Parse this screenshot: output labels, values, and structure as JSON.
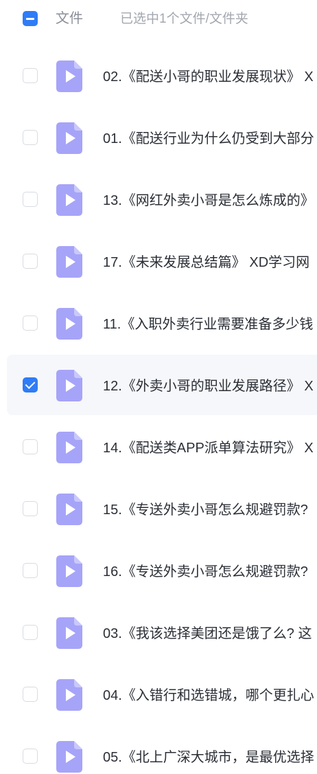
{
  "header": {
    "column_label": "文件",
    "selection_text": "已选中1个文件/文件夹",
    "select_all_state": "indeterminate"
  },
  "colors": {
    "accent": "#2f7cf6",
    "file_icon": "#a6a4f8",
    "selected_row_bg": "#f6f7fa"
  },
  "files": [
    {
      "name": "02.《配送小哥的职业发展现状》 X",
      "selected": false,
      "icon": "video-file-icon"
    },
    {
      "name": "01.《配送行业为什么仍受到大部分",
      "selected": false,
      "icon": "video-file-icon"
    },
    {
      "name": "13.《网红外卖小哥是怎么炼成的》",
      "selected": false,
      "icon": "video-file-icon"
    },
    {
      "name": "17.《未来发展总结篇》 XD学习网",
      "selected": false,
      "icon": "video-file-icon"
    },
    {
      "name": "11.《入职外卖行业需要准备多少钱",
      "selected": false,
      "icon": "video-file-icon"
    },
    {
      "name": "12.《外卖小哥的职业发展路径》 X",
      "selected": true,
      "icon": "video-file-icon"
    },
    {
      "name": "14.《配送类APP派单算法研究》 X",
      "selected": false,
      "icon": "video-file-icon"
    },
    {
      "name": "15.《专送外卖小哥怎么规避罚款?",
      "selected": false,
      "icon": "video-file-icon"
    },
    {
      "name": "16.《专送外卖小哥怎么规避罚款?",
      "selected": false,
      "icon": "video-file-icon"
    },
    {
      "name": "03.《我该选择美团还是饿了么? 这",
      "selected": false,
      "icon": "video-file-icon"
    },
    {
      "name": "04.《入错行和选错城，哪个更扎心",
      "selected": false,
      "icon": "video-file-icon"
    },
    {
      "name": "05.《北上广深大城市，是最优选择",
      "selected": false,
      "icon": "video-file-icon"
    }
  ]
}
